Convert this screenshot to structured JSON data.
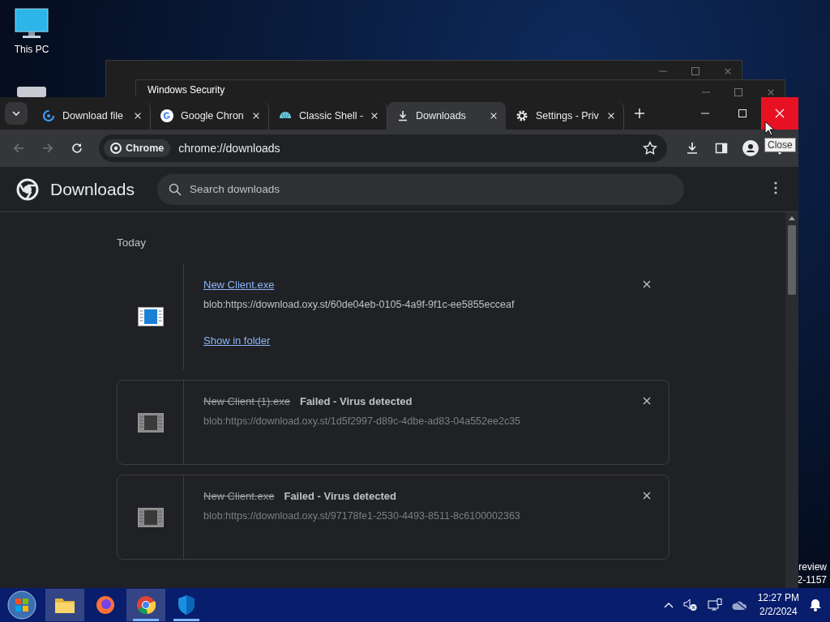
{
  "desktop": {
    "icons": [
      {
        "label": "This PC",
        "kind": "monitor"
      },
      {
        "kind": "drive"
      }
    ],
    "text_lines": [
      "review",
      "2-1157"
    ]
  },
  "background_windows": [
    {
      "kind": "plain"
    },
    {
      "kind": "titled",
      "title": "Windows Security"
    }
  ],
  "browser": {
    "tabs": [
      {
        "title": "Download file",
        "kind": "swirl",
        "selected": false
      },
      {
        "title": "Google Chron",
        "kind": "google",
        "selected": false
      },
      {
        "title": "Classic Shell -",
        "kind": "shell",
        "selected": false
      },
      {
        "title": "Downloads",
        "kind": "download",
        "selected": true
      },
      {
        "title": "Settings - Priv",
        "kind": "gear",
        "selected": false
      }
    ],
    "close_hovered": true,
    "tooltip": "Close",
    "toolbar": {
      "back_disabled": true,
      "forward_disabled": true,
      "chip": "Chrome",
      "url": "chrome://downloads"
    },
    "page": {
      "title": "Downloads",
      "search_placeholder": "Search downloads",
      "date_header": "Today",
      "items": [
        {
          "name": "New Client.exe",
          "failed": false,
          "url": "blob:https://download.oxy.st/60de04eb-0105-4a9f-9f1c-ee5855ecceaf",
          "action": "Show in folder",
          "bordered": false
        },
        {
          "name": "New Client (1).exe",
          "status": "Failed - Virus detected",
          "failed": true,
          "url": "blob:https://download.oxy.st/1d5f2997-d89c-4dbe-ad83-04a552ee2c35",
          "bordered": true
        },
        {
          "name": "New Client.exe",
          "status": "Failed - Virus detected",
          "failed": true,
          "url": "blob:https://download.oxy.st/97178fe1-2530-4493-8511-8c6100002363",
          "bordered": true
        }
      ]
    }
  },
  "taskbar": {
    "apps": [
      {
        "kind": "start",
        "running": false,
        "selected": false
      },
      {
        "kind": "folder",
        "running": false,
        "selected": true
      },
      {
        "kind": "firefox",
        "running": false,
        "selected": false
      },
      {
        "kind": "chrome",
        "running": true,
        "selected": true
      },
      {
        "kind": "shield",
        "running": true,
        "selected": false
      }
    ],
    "time": "12:27 PM",
    "date": "2/2/2024"
  }
}
